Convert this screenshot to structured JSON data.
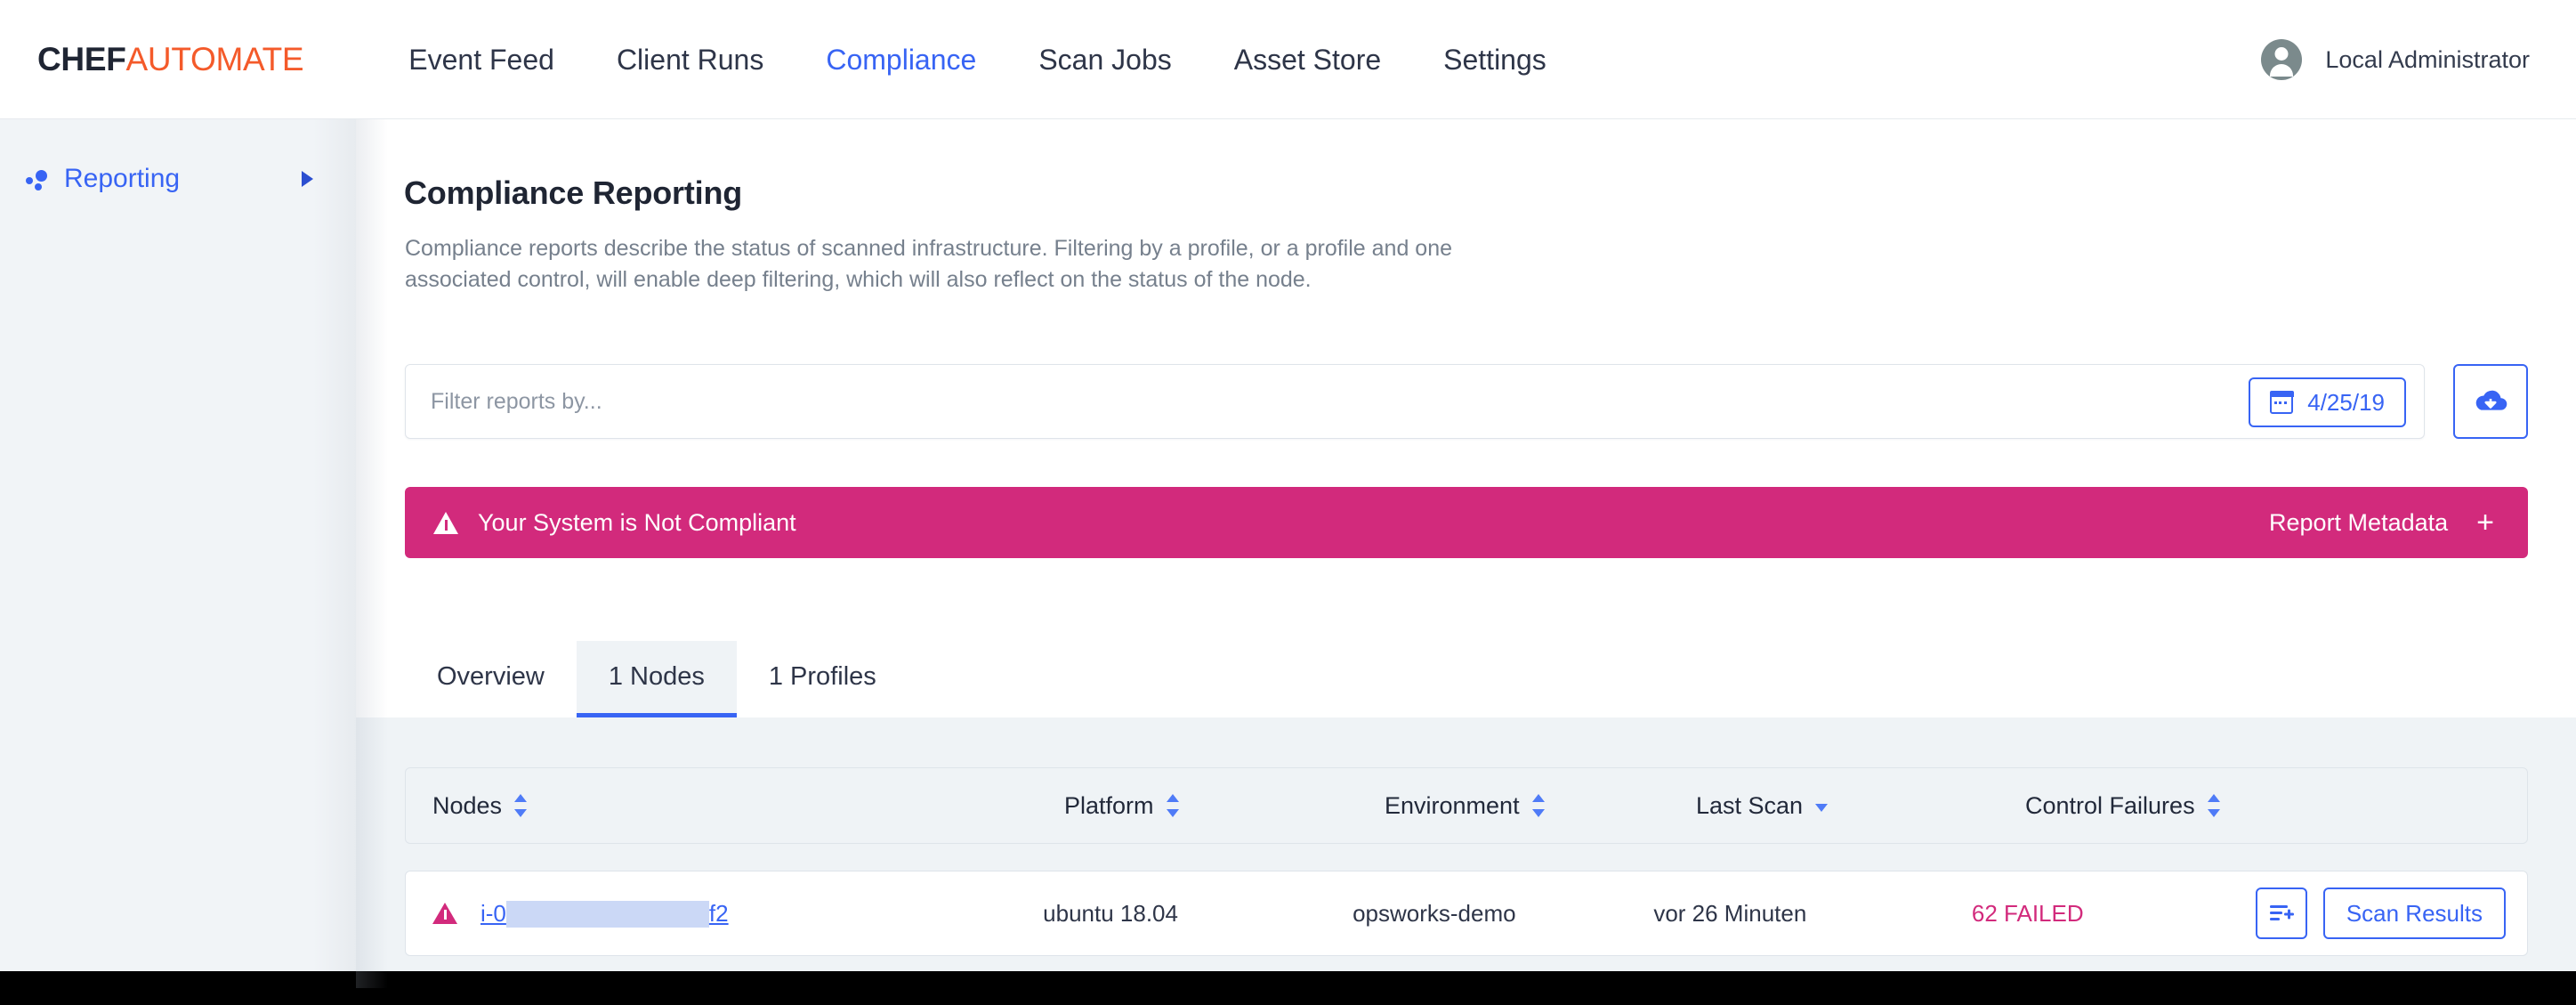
{
  "brand": {
    "logo_primary": "CHEF",
    "logo_secondary": "AUTOMATE",
    "accent_blue": "#3864f4",
    "accent_orange": "#f45a2a",
    "accent_magenta": "#d22a7c"
  },
  "topnav": {
    "menu": [
      {
        "label": "Event Feed",
        "active": false
      },
      {
        "label": "Client Runs",
        "active": false
      },
      {
        "label": "Compliance",
        "active": true
      },
      {
        "label": "Scan Jobs",
        "active": false
      },
      {
        "label": "Asset Store",
        "active": false
      },
      {
        "label": "Settings",
        "active": false
      }
    ],
    "user": {
      "name": "Local Administrator",
      "avatar_icon": "user-avatar-icon"
    }
  },
  "sidebar": {
    "items": [
      {
        "label": "Reporting",
        "icon": "reporting-dots-icon",
        "expand_icon": "caret-right-icon",
        "active": true
      }
    ]
  },
  "main": {
    "title": "Compliance Reporting",
    "description": "Compliance reports describe the status of scanned infrastructure. Filtering by a profile, or a profile and one associated control, will enable deep filtering, which will also reflect on the status of the node.",
    "filter": {
      "placeholder": "Filter reports by...",
      "value": "",
      "date_value": "4/25/19",
      "calendar_icon": "calendar-icon",
      "download_icon": "cloud-download-icon"
    },
    "alert": {
      "icon": "warning-triangle-icon",
      "text": "Your System is Not Compliant",
      "metadata_label": "Report Metadata",
      "metadata_toggle": "+"
    },
    "tabs": [
      {
        "label": "Overview",
        "active": false
      },
      {
        "label": "1 Nodes",
        "active": true
      },
      {
        "label": "1 Profiles",
        "active": false
      }
    ],
    "table": {
      "columns": [
        {
          "label": "Nodes",
          "sort": "none"
        },
        {
          "label": "Platform",
          "sort": "none"
        },
        {
          "label": "Environment",
          "sort": "none"
        },
        {
          "label": "Last Scan",
          "sort": "desc"
        },
        {
          "label": "Control Failures",
          "sort": "none"
        }
      ],
      "rows": [
        {
          "status_icon": "warning-triangle-icon",
          "node_prefix": "i-0",
          "node_suffix": "f2",
          "platform": "ubuntu 18.04",
          "environment": "opsworks-demo",
          "last_scan": "vor 26 Minuten",
          "control_failures": "62 FAILED",
          "add_icon": "add-to-list-icon",
          "scan_results_label": "Scan Results"
        }
      ]
    }
  }
}
